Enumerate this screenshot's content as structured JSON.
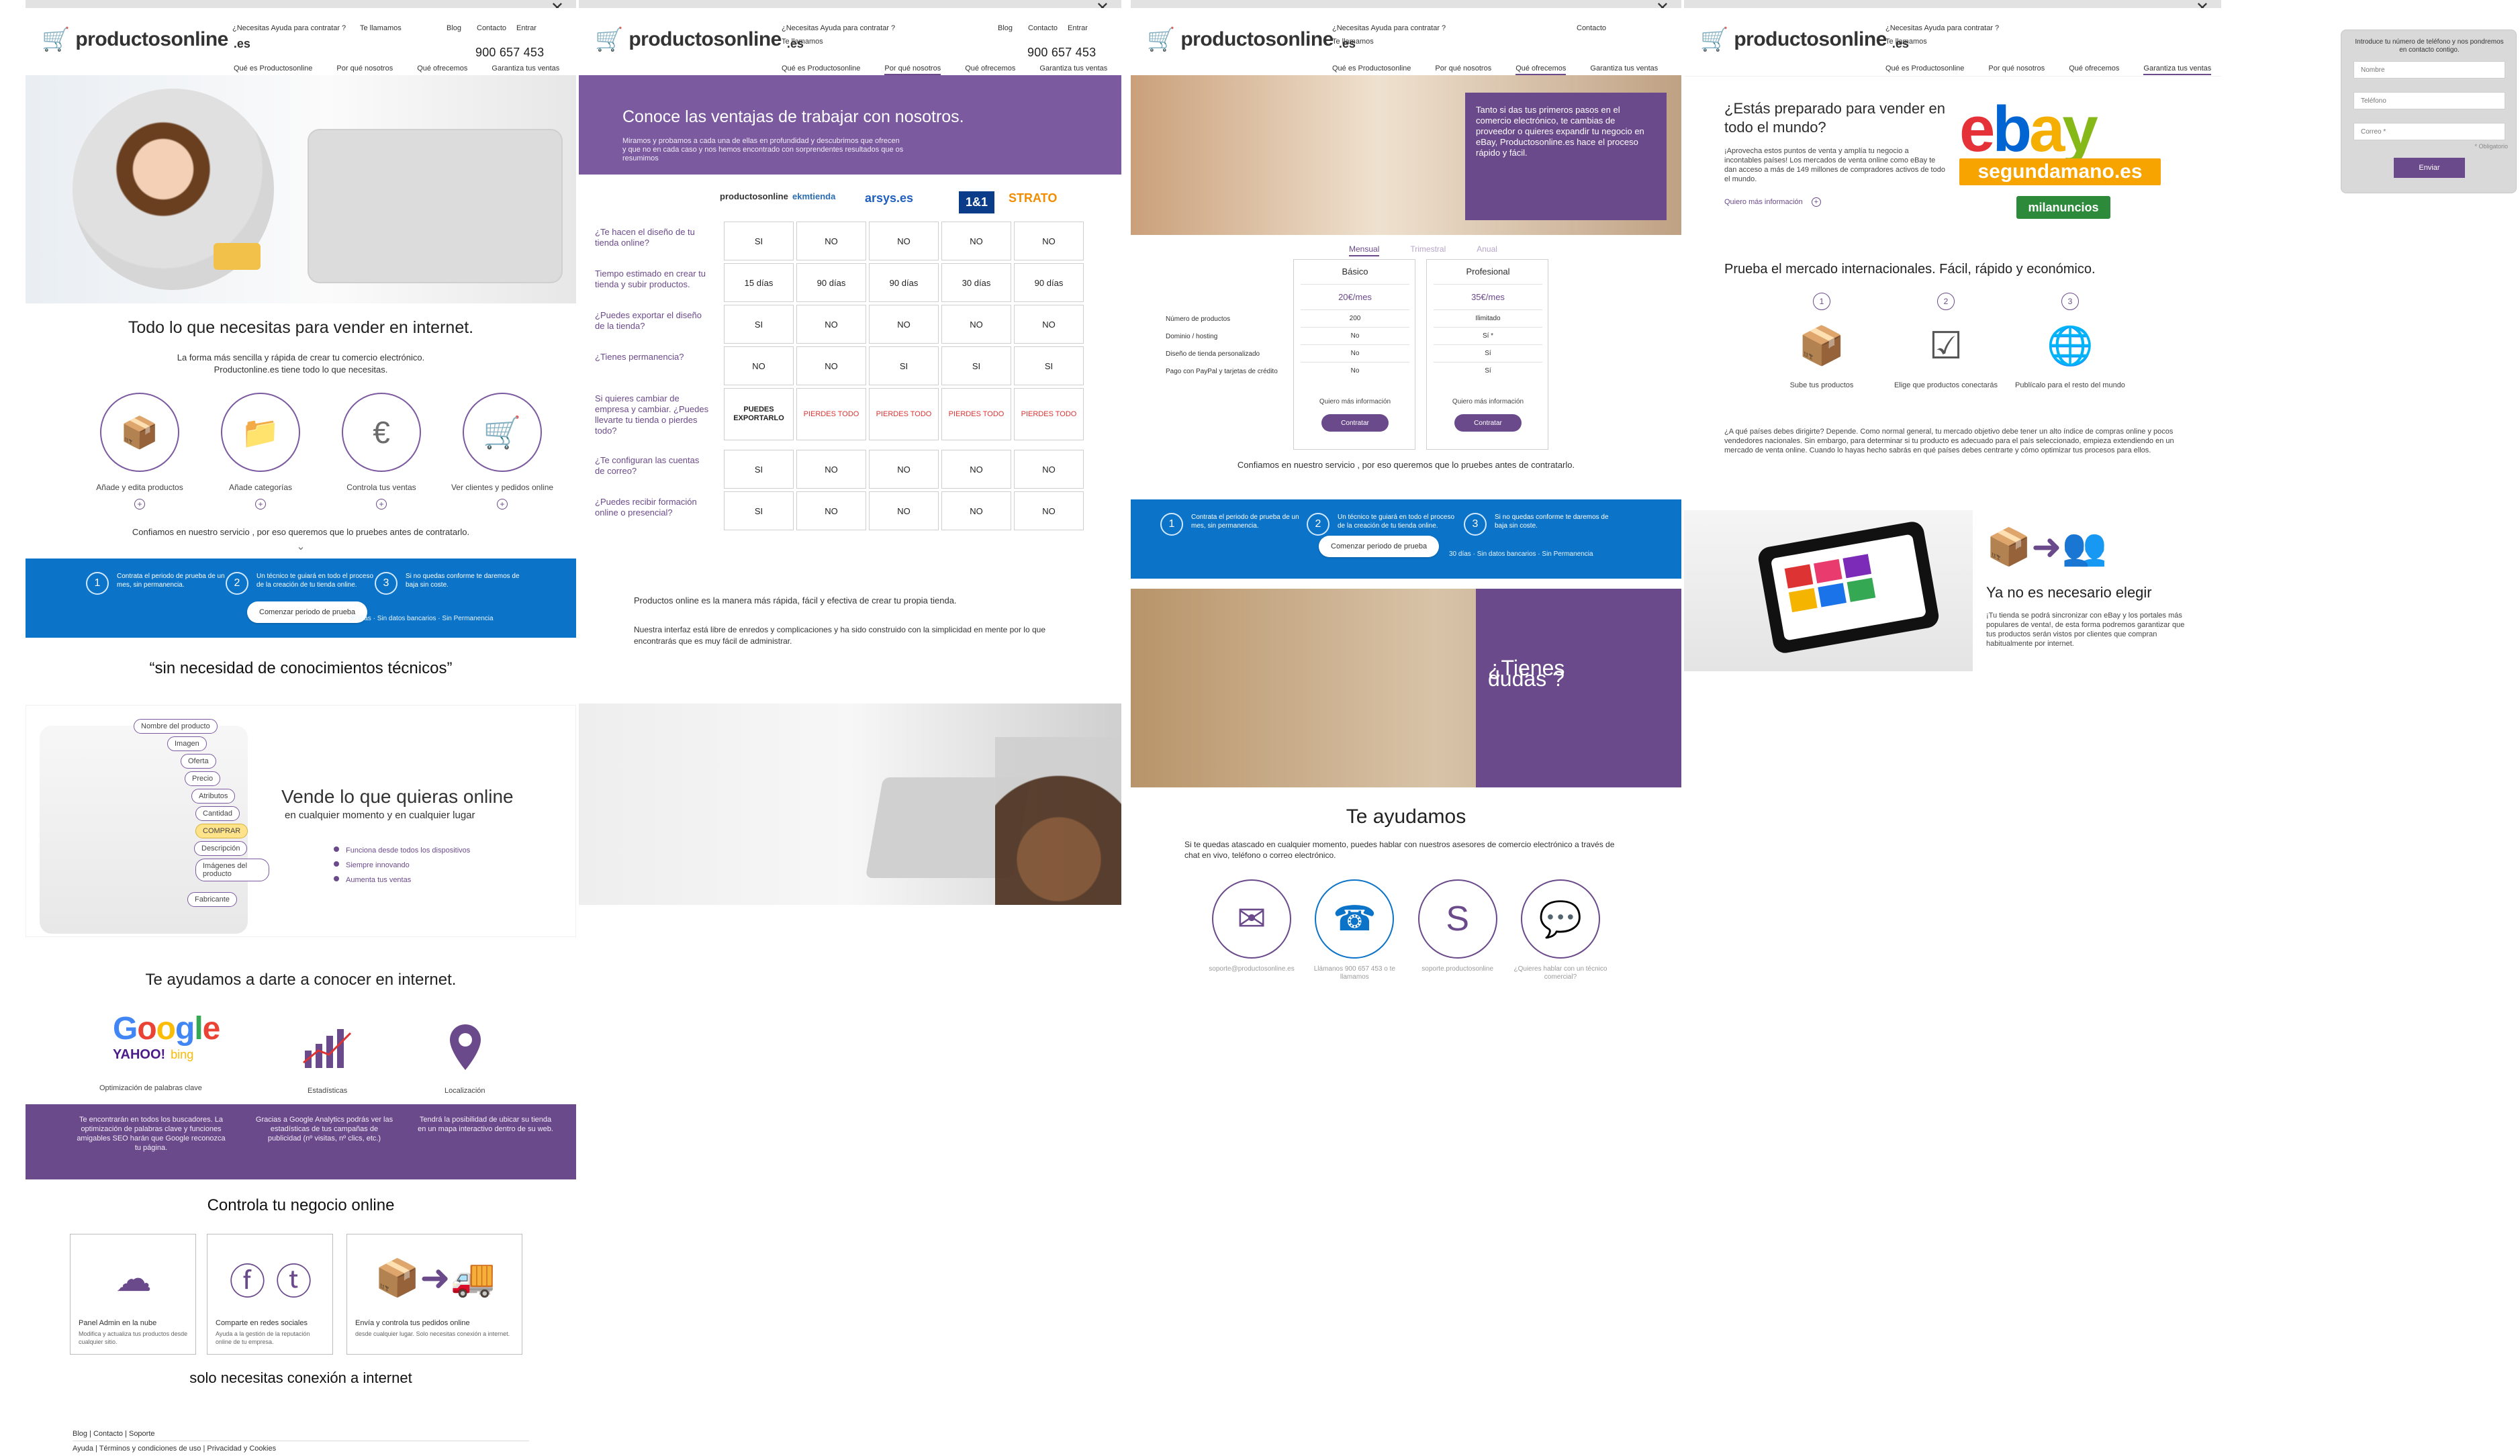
{
  "brand": {
    "name": "productosonline",
    "tld": ".es"
  },
  "common": {
    "close": "✕",
    "help_contract": "¿Necesitas Ayuda para contratar ?",
    "call_us": "Te llamamos",
    "phone": "900 657 453",
    "top_links": [
      "Blog",
      "Contacto",
      "Entrar"
    ],
    "nav": [
      "Qué es Productosonline",
      "Por qué nosotros",
      "Qué ofrecemos",
      "Garantiza tus ventas"
    ]
  },
  "page1": {
    "title": "Todo lo que necesitas para vender en internet.",
    "subtitle_1": "La forma más sencilla y rápida de crear tu comercio electrónico.",
    "subtitle_2": "Productonline.es tiene todo lo que necesitas.",
    "features": [
      {
        "icon": "box-icon",
        "label": "Añade y edita productos"
      },
      {
        "icon": "folder-icon",
        "label": "Añade categorías"
      },
      {
        "icon": "euro-house-icon",
        "label": "Controla tus ventas"
      },
      {
        "icon": "cart-icon",
        "label": "Ver clientes y pedidos online"
      }
    ],
    "trust_text": "Confiamos en nuestro servicio , por eso queremos que lo pruebes antes de contratarlo.",
    "steps": [
      {
        "num": "1",
        "text": "Contrata el periodo de prueba de un mes, sin permanencia."
      },
      {
        "num": "2",
        "text": "Un técnico te guiará en todo el proceso de la creación de tu tienda online."
      },
      {
        "num": "3",
        "text": "Si no quedas conforme te daremos de baja sin coste."
      }
    ],
    "trial_button": "Comenzar periodo de prueba",
    "trial_note": "30 días · Sin datos bancarios · Sin Permanencia",
    "quote": "“sin necesidad de conocimientos técnicos”",
    "phone_tags": [
      "Nombre del producto",
      "Imagen",
      "Oferta",
      "Precio",
      "Atributos",
      "Cantidad",
      "COMPRAR",
      "Descripción",
      "Imágenes del producto",
      "Fabricante"
    ],
    "sell_title": "Vende lo que quieras online",
    "sell_sub": "en cualquier momento y en cualquier lugar",
    "bullets": [
      "Funciona desde todos los dispositivos",
      "Siempre innovando",
      "Aumenta tus ventas"
    ],
    "seo_title": "Te ayudamos a darte a conocer en internet.",
    "seo_caps": [
      "Optimización de palabras clave",
      "Estadísticas",
      "Localización"
    ],
    "seo_texts": [
      "Te encontrarán en todos los buscadores. La optimización de palabras clave y funciones amigables SEO harán que Google reconozca tu página.",
      "Gracias a Google Analytics podrás ver las estadísticas de tus campañas de publicidad (nº visitas, nº clics, etc.)",
      "Tendrá la posibilidad de ubicar su tienda en un mapa interactivo dentro de su web."
    ],
    "control_title": "Controla tu negocio online",
    "control_boxes": [
      {
        "icon": "cloud-upload-icon",
        "title": "Panel Admin en la nube",
        "desc": "Modifica y actualiza tus productos desde cualquier sitio."
      },
      {
        "icon": "social-icon",
        "title": "Comparte en redes sociales",
        "desc": "Ayuda a la gestión de la reputación online de tu empresa."
      },
      {
        "icon": "shipping-icon",
        "title": "Envía y controla tus pedidos online",
        "desc": "desde cualquier lugar. Solo necesitas conexión a internet."
      }
    ],
    "connection": "solo necesitas conexión a internet",
    "footer_1": "Blog | Contacto | Soporte",
    "footer_2": "Ayuda | Términos y condiciones de uso | Privacidad y Cookies"
  },
  "page2": {
    "title": "Conoce las ventajas de trabajar con nosotros.",
    "subtitle": "Miramos y probamos a cada una de ellas en profundidad y descubrimos que ofrecen y que no en cada caso y nos hemos encontrado con sorprendentes resultados que os resumimos",
    "brands": [
      "productosonline",
      "ekmtienda",
      "arsys.es",
      "1&1",
      "STRATO"
    ],
    "rows": [
      {
        "q": "¿Te hacen el diseño de tu tienda online?",
        "vals": [
          "SI",
          "NO",
          "NO",
          "NO",
          "NO"
        ]
      },
      {
        "q": "Tiempo estimado en crear tu tienda y subir productos.",
        "vals": [
          "15 días",
          "90 días",
          "90 días",
          "30 días",
          "90 días"
        ]
      },
      {
        "q": "¿Puedes exportar el diseño de la tienda?",
        "vals": [
          "SI",
          "NO",
          "NO",
          "NO",
          "NO"
        ]
      },
      {
        "q": "¿Tienes permanencia?",
        "vals": [
          "NO",
          "NO",
          "SI",
          "SI",
          "SI"
        ]
      },
      {
        "q": "Si quieres cambiar de empresa y cambiar. ¿Puedes llevarte tu tienda o pierdes todo?",
        "vals": [
          "PUEDES EXPORTARLO",
          "PIERDES TODO",
          "PIERDES TODO",
          "PIERDES TODO",
          "PIERDES TODO"
        ]
      },
      {
        "q": "¿Te configuran las cuentas de correo?",
        "vals": [
          "SI",
          "NO",
          "NO",
          "NO",
          "NO"
        ]
      },
      {
        "q": "¿Puedes recibir formación online o presencial?",
        "vals": [
          "SI",
          "NO",
          "NO",
          "NO",
          "NO"
        ]
      }
    ],
    "text_1": "Productos online es la manera más rápida, fácil y efectiva de crear tu propia tienda.",
    "text_2": "Nuestra interfaz está libre de enredos y complicaciones y ha sido construido con la simplicidad en mente por lo que encontrarás que es muy fácil de administrar."
  },
  "page3": {
    "hero_text": "Tanto si das tus primeros pasos en el comercio electrónico, te cambias de proveedor o quieres expandir tu negocio en eBay, Productosonline.es hace el proceso rápido y fácil.",
    "tabs": [
      "Mensual",
      "Trimestral",
      "Anual"
    ],
    "plans": [
      {
        "name": "Básico",
        "price": "20€/mes",
        "values": [
          "200",
          "No",
          "No",
          "No"
        ],
        "more": "Quiero más información",
        "cta": "Contratar"
      },
      {
        "name": "Profesional",
        "price": "35€/mes",
        "values": [
          "Ilimitado",
          "Sí *",
          "Sí",
          "Sí"
        ],
        "more": "Quiero más información",
        "cta": "Contratar"
      }
    ],
    "features": [
      "Número de productos",
      "Dominio / hosting",
      "Diseño de tienda personalizado",
      "Pago con PayPal y tarjetas de crédito"
    ],
    "trust_text": "Confiamos en nuestro servicio , por eso queremos que lo pruebes antes de contratarlo.",
    "steps": [
      {
        "num": "1",
        "text": "Contrata el periodo de prueba de un mes, sin permanencia."
      },
      {
        "num": "2",
        "text": "Un técnico te guiará en todo el proceso de la creación de tu tienda online."
      },
      {
        "num": "3",
        "text": "Si no quedas conforme te daremos de baja sin coste."
      }
    ],
    "trial_button": "Comenzar periodo de prueba",
    "trial_note": "30 días · Sin datos bancarios · Sin Permanencia",
    "dudas": "¿Tienes dudas ?",
    "help_title": "Te ayudamos",
    "help_text": "Si te quedas atascado en cualquier momento, puedes hablar con nuestros asesores de comercio electrónico a través de chat en vivo, teléfono o correo electrónico.",
    "contacts": [
      {
        "icon": "mail-icon",
        "cap": "soporte@productosonline.es"
      },
      {
        "icon": "phone-icon",
        "cap": "Llámanos 900 657 453 o te llamamos"
      },
      {
        "icon": "skype-icon",
        "cap": "soporte.productosonline"
      },
      {
        "icon": "chat-icon",
        "cap": "¿Quieres hablar con un técnico comercial?"
      }
    ]
  },
  "page4": {
    "title": "¿Estás preparado para vender en todo el mundo?",
    "desc": "¡Aprovecha estos puntos de venta y amplía tu negocio a incontables países! Los mercados de venta online como eBay te dan acceso a más de 149 millones de compradores activos de todo el mundo.",
    "more": "Quiero más información",
    "ebay_logos": [
      "ebay",
      "segundamano.es",
      "milanuncios"
    ],
    "market_title": "Prueba el mercado internacionales.  Fácil, rápido y económico.",
    "steps": [
      {
        "num": "1",
        "icon": "box-icon",
        "cap": "Sube tus productos"
      },
      {
        "num": "2",
        "icon": "check-icon",
        "cap": "Elige que productos conectarás"
      },
      {
        "num": "3",
        "icon": "globe-icon",
        "cap": "Publícalo para el resto del mundo"
      }
    ],
    "para": "¿A qué países debes dirigirte? Depende. Como normal general, tu mercado objetivo debe tener un alto índice de compras online y pocos vendedores nacionales. Sin embargo, para determinar si tu producto es adecuado para el país seleccionado, empieza extendiendo en un mercado de venta online. Cuando lo hayas hecho sabrás en qué países debes centrarte y cómo optimizar tus procesos para ellos.",
    "no_choice_title": "Ya no es necesario elegir",
    "no_choice_desc": "¡Tu tienda se podrá sincronizar con eBay y los portales más populares de venta!, de esta forma podremos garantizar que tus productos serán vistos por clientes que compran habitualmente por internet."
  },
  "callback": {
    "title": "Introduce tu número de teléfono y nos pondremos en contacto contigo.",
    "name_ph": "Nombre",
    "phone_ph": "Teléfono",
    "email_ph": "Correo *",
    "required": "* Obligatorio",
    "send": "Enviar"
  }
}
